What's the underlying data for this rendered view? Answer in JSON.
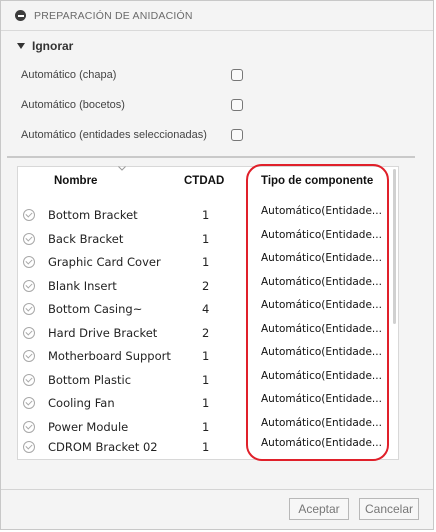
{
  "dialog": {
    "title": "PREPARACIÓN DE ANIDACIÓN",
    "section": "Ignorar",
    "options": [
      {
        "label": "Automático (chapa)",
        "checked": false
      },
      {
        "label": "Automático (bocetos)",
        "checked": false
      },
      {
        "label": "Automático (entidades seleccionadas)",
        "checked": false
      }
    ]
  },
  "table": {
    "headers": {
      "name": "Nombre",
      "qty": "CTDAD",
      "type": "Tipo de componente"
    },
    "rows": [
      {
        "name": "Bottom Bracket",
        "qty": "1",
        "type": "Automático(Entidade..."
      },
      {
        "name": "Back Bracket",
        "qty": "1",
        "type": "Automático(Entidade..."
      },
      {
        "name": "Graphic Card Cover",
        "qty": "1",
        "type": "Automático(Entidade..."
      },
      {
        "name": "Blank Insert",
        "qty": "2",
        "type": "Automático(Entidade..."
      },
      {
        "name": "Bottom Casing~",
        "qty": "4",
        "type": "Automático(Entidade..."
      },
      {
        "name": "Hard Drive Bracket",
        "qty": "2",
        "type": "Automático(Entidade..."
      },
      {
        "name": "Motherboard Support",
        "qty": "1",
        "type": "Automático(Entidade..."
      },
      {
        "name": "Bottom Plastic",
        "qty": "1",
        "type": "Automático(Entidade..."
      },
      {
        "name": "Cooling Fan",
        "qty": "1",
        "type": "Automático(Entidade..."
      },
      {
        "name": "Power Module",
        "qty": "1",
        "type": "Automático(Entidade..."
      },
      {
        "name": "CDROM Bracket 02",
        "qty": "1",
        "type": "Automático(Entidade..."
      }
    ]
  },
  "buttons": {
    "ok": "Aceptar",
    "cancel": "Cancelar"
  },
  "colors": {
    "highlight": "#e0202a",
    "background": "#f4f4f4"
  }
}
